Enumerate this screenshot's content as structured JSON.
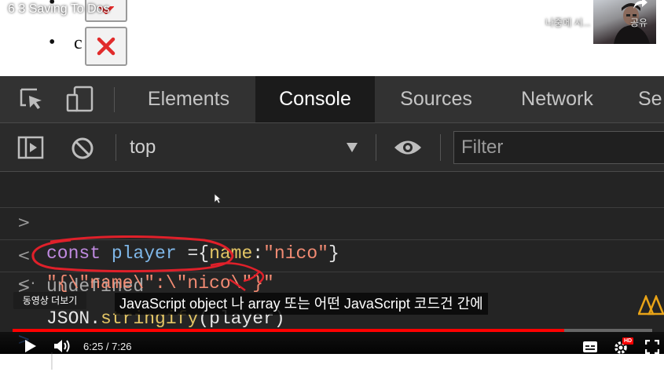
{
  "video": {
    "title": "6 3 Saving To Dos",
    "watch_later_label": "나중에 시...",
    "share_label": "공유"
  },
  "page": {
    "bullet_letter": "c"
  },
  "devtools": {
    "tabs": [
      {
        "label": "Elements",
        "active": false
      },
      {
        "label": "Console",
        "active": true
      },
      {
        "label": "Sources",
        "active": false
      },
      {
        "label": "Network",
        "active": false
      },
      {
        "label": "Se",
        "active": false
      }
    ],
    "context_value": "top",
    "filter_placeholder": "Filter",
    "console": {
      "line1": {
        "prompt": ">",
        "kw": "const",
        "var": "player",
        "eq": " =",
        "open": "{",
        "prop": "name",
        "colon": ":",
        "str": "\"nico\"",
        "close": "}"
      },
      "line2": {
        "prompt": "<·",
        "text": "undefined"
      },
      "line3": {
        "prompt": ">",
        "fn_obj": "JSON",
        "dot": ".",
        "fn": "stringify",
        "args": "(player)"
      },
      "line4": {
        "prompt": "<·",
        "text": "\"{\\\"name\\\":\\\"nico\\\"}\""
      },
      "line5": {
        "prompt": ">",
        "text": "|"
      }
    }
  },
  "player": {
    "more_videos_label": "동영상 더보기",
    "subtitle": "JavaScript object 나 array 또는 어떤 JavaScript 코드건 간에",
    "current_time": "6:25",
    "duration": "7:26",
    "time_text": "6:25 / 7:26",
    "progress": 0.863,
    "quality_badge": "HD",
    "accent_color": "#ff0000"
  },
  "colors": {
    "devtools_bg": "#242424",
    "tabbar_bg": "#323232",
    "annotation_red": "#e0202a"
  }
}
